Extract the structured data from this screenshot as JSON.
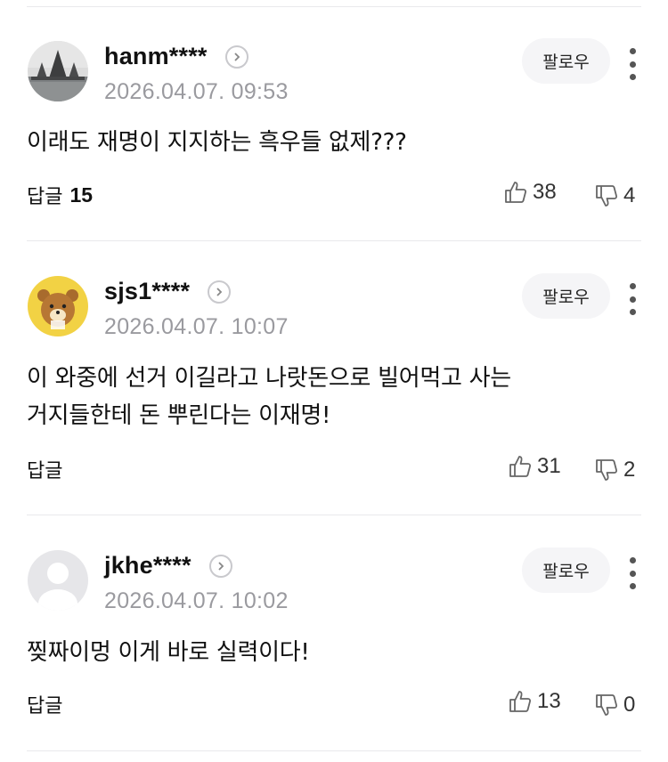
{
  "follow_label": "팔로우",
  "reply_label": "답글",
  "comments": [
    {
      "username": "hanm****",
      "timestamp": "2026.04.07. 09:53",
      "text": "이래도 재명이 지지하는 흑우들 없제???",
      "reply_count": "15",
      "likes": "38",
      "dislikes": "4",
      "avatar": "temple-photo"
    },
    {
      "username": "sjs1****",
      "timestamp": "2026.04.07. 10:07",
      "text": "이 와중에 선거 이길라고 나랏돈으로 빌어먹고 사는\n거지들한테 돈 뿌린다는 이재명!",
      "reply_count": "",
      "likes": "31",
      "dislikes": "2",
      "avatar": "bear-character"
    },
    {
      "username": "jkhe****",
      "timestamp": "2026.04.07. 10:02",
      "text": "찢짜이멍 이게 바로 실력이다!",
      "reply_count": "",
      "likes": "13",
      "dislikes": "0",
      "avatar": "default-user"
    }
  ]
}
